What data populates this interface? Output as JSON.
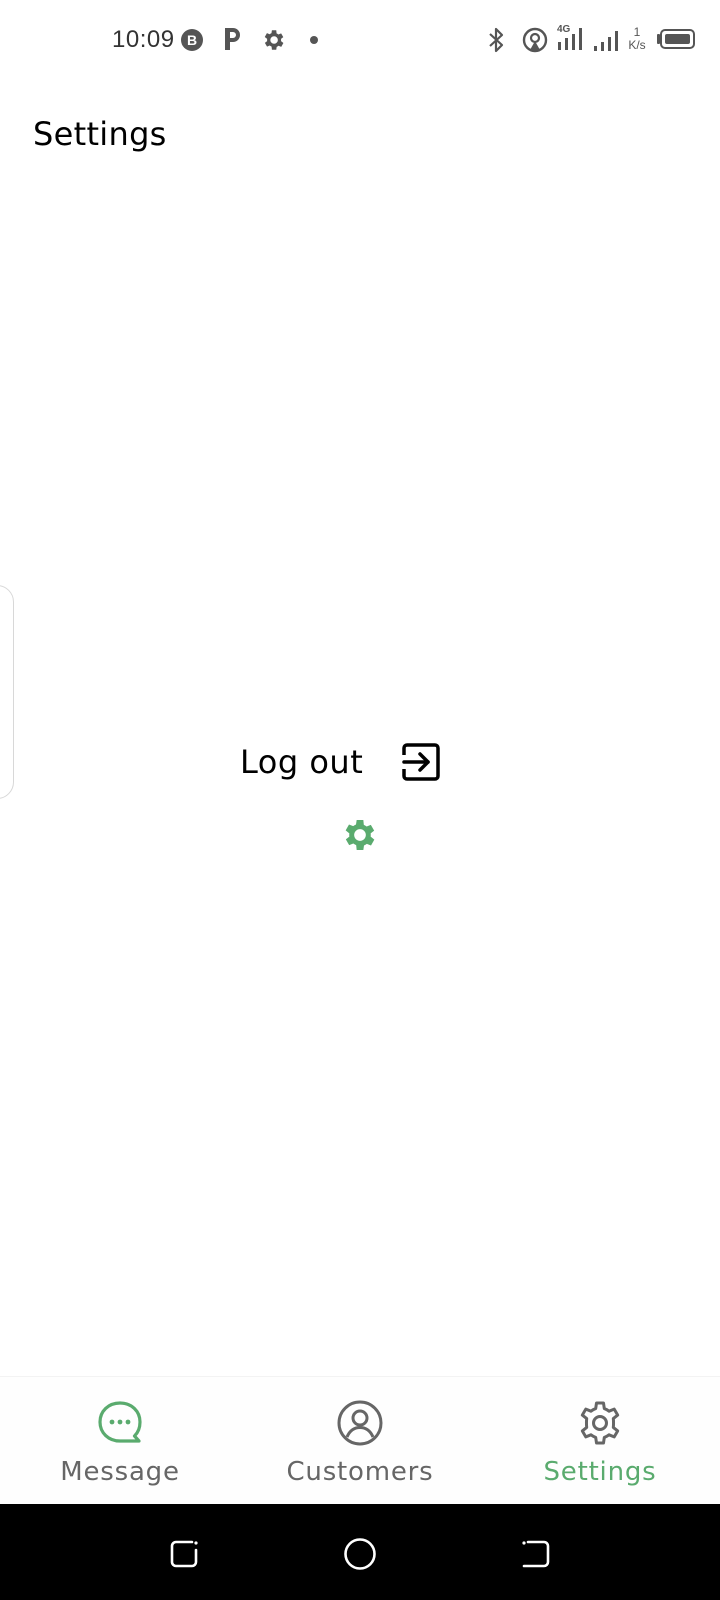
{
  "status_bar": {
    "time": "10:09",
    "net_speed_value": "1",
    "net_speed_unit": "K/s",
    "icons": [
      "b-circle-icon",
      "p-icon",
      "gear-icon",
      "dot-icon",
      "bluetooth-icon",
      "hotspot-icon",
      "signal-4g-icon",
      "signal-icon",
      "battery-icon"
    ]
  },
  "header": {
    "title": "Settings"
  },
  "main": {
    "logout_label": "Log out",
    "logout_icon": "logout-icon",
    "loading_icon": "gear-icon"
  },
  "bottom_nav": {
    "items": [
      {
        "label": "Message",
        "icon": "chat-bubble-icon",
        "active": false
      },
      {
        "label": "Customers",
        "icon": "user-circle-icon",
        "active": false
      },
      {
        "label": "Settings",
        "icon": "gear-icon",
        "active": true
      }
    ]
  },
  "system_nav": {
    "buttons": [
      "recents",
      "home",
      "back"
    ]
  },
  "colors": {
    "accent": "#5aab6e",
    "inactive": "#666666",
    "text": "#000000",
    "system_nav_bg": "#000000"
  }
}
